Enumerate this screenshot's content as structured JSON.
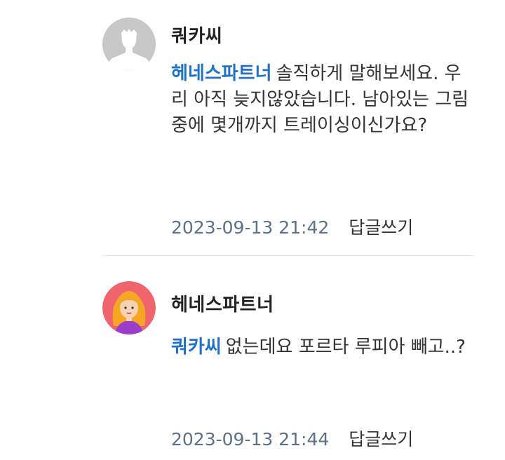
{
  "comments": [
    {
      "author": "쿼카씨",
      "mention": "헤네스파트너",
      "text": "솔직하게 말해보세요. 우리 아직 늦지않았습니다. 남아있는 그림 중에 몇개까지 트레이싱이신가요?",
      "date": "2023-09-13 21:42",
      "reply_label": "답글쓰기",
      "avatar_icon": "default-profile-icon"
    },
    {
      "author": "헤네스파트너",
      "mention": "쿼카씨",
      "text": "없는데요 포르타 루피아 빼고..?",
      "date": "2023-09-13 21:44",
      "reply_label": "답글쓰기",
      "avatar_icon": "girl-avatar-icon"
    }
  ],
  "colors": {
    "mention": "#1f72c7",
    "meta": "#5b7189",
    "divider": "#e6e6e6"
  }
}
